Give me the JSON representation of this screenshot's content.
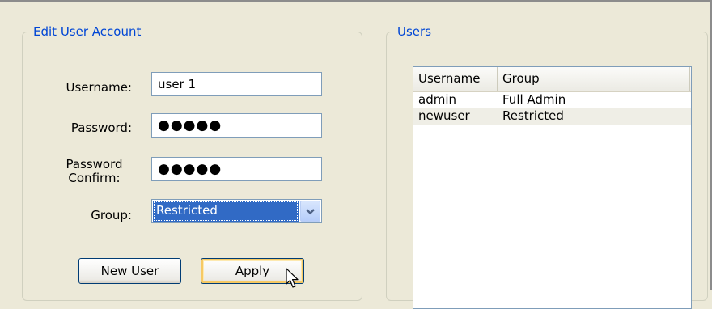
{
  "edit_account": {
    "title": "Edit User Account",
    "username_label": "Username:",
    "username_value": "user 1",
    "password_label": "Password:",
    "password_value": "●●●●●",
    "confirm_label_line1": "Password",
    "confirm_label_line2": "Confirm:",
    "confirm_value": "●●●●●",
    "group_label": "Group:",
    "group_value": "Restricted",
    "new_user_button": "New User",
    "apply_button": "Apply"
  },
  "users": {
    "title": "Users",
    "columns": [
      "Username",
      "Group"
    ],
    "rows": [
      {
        "username": "admin",
        "group": "Full Admin"
      },
      {
        "username": "newuser",
        "group": "Restricted"
      }
    ]
  },
  "colors": {
    "window_bg": "#ece9d8",
    "legend_text": "#0046d5",
    "selection": "#316ac5",
    "input_border": "#7f9db9",
    "default_button_highlight": "#f6c964"
  },
  "icons": [
    "chevron-down-icon",
    "mouse-cursor-icon"
  ]
}
